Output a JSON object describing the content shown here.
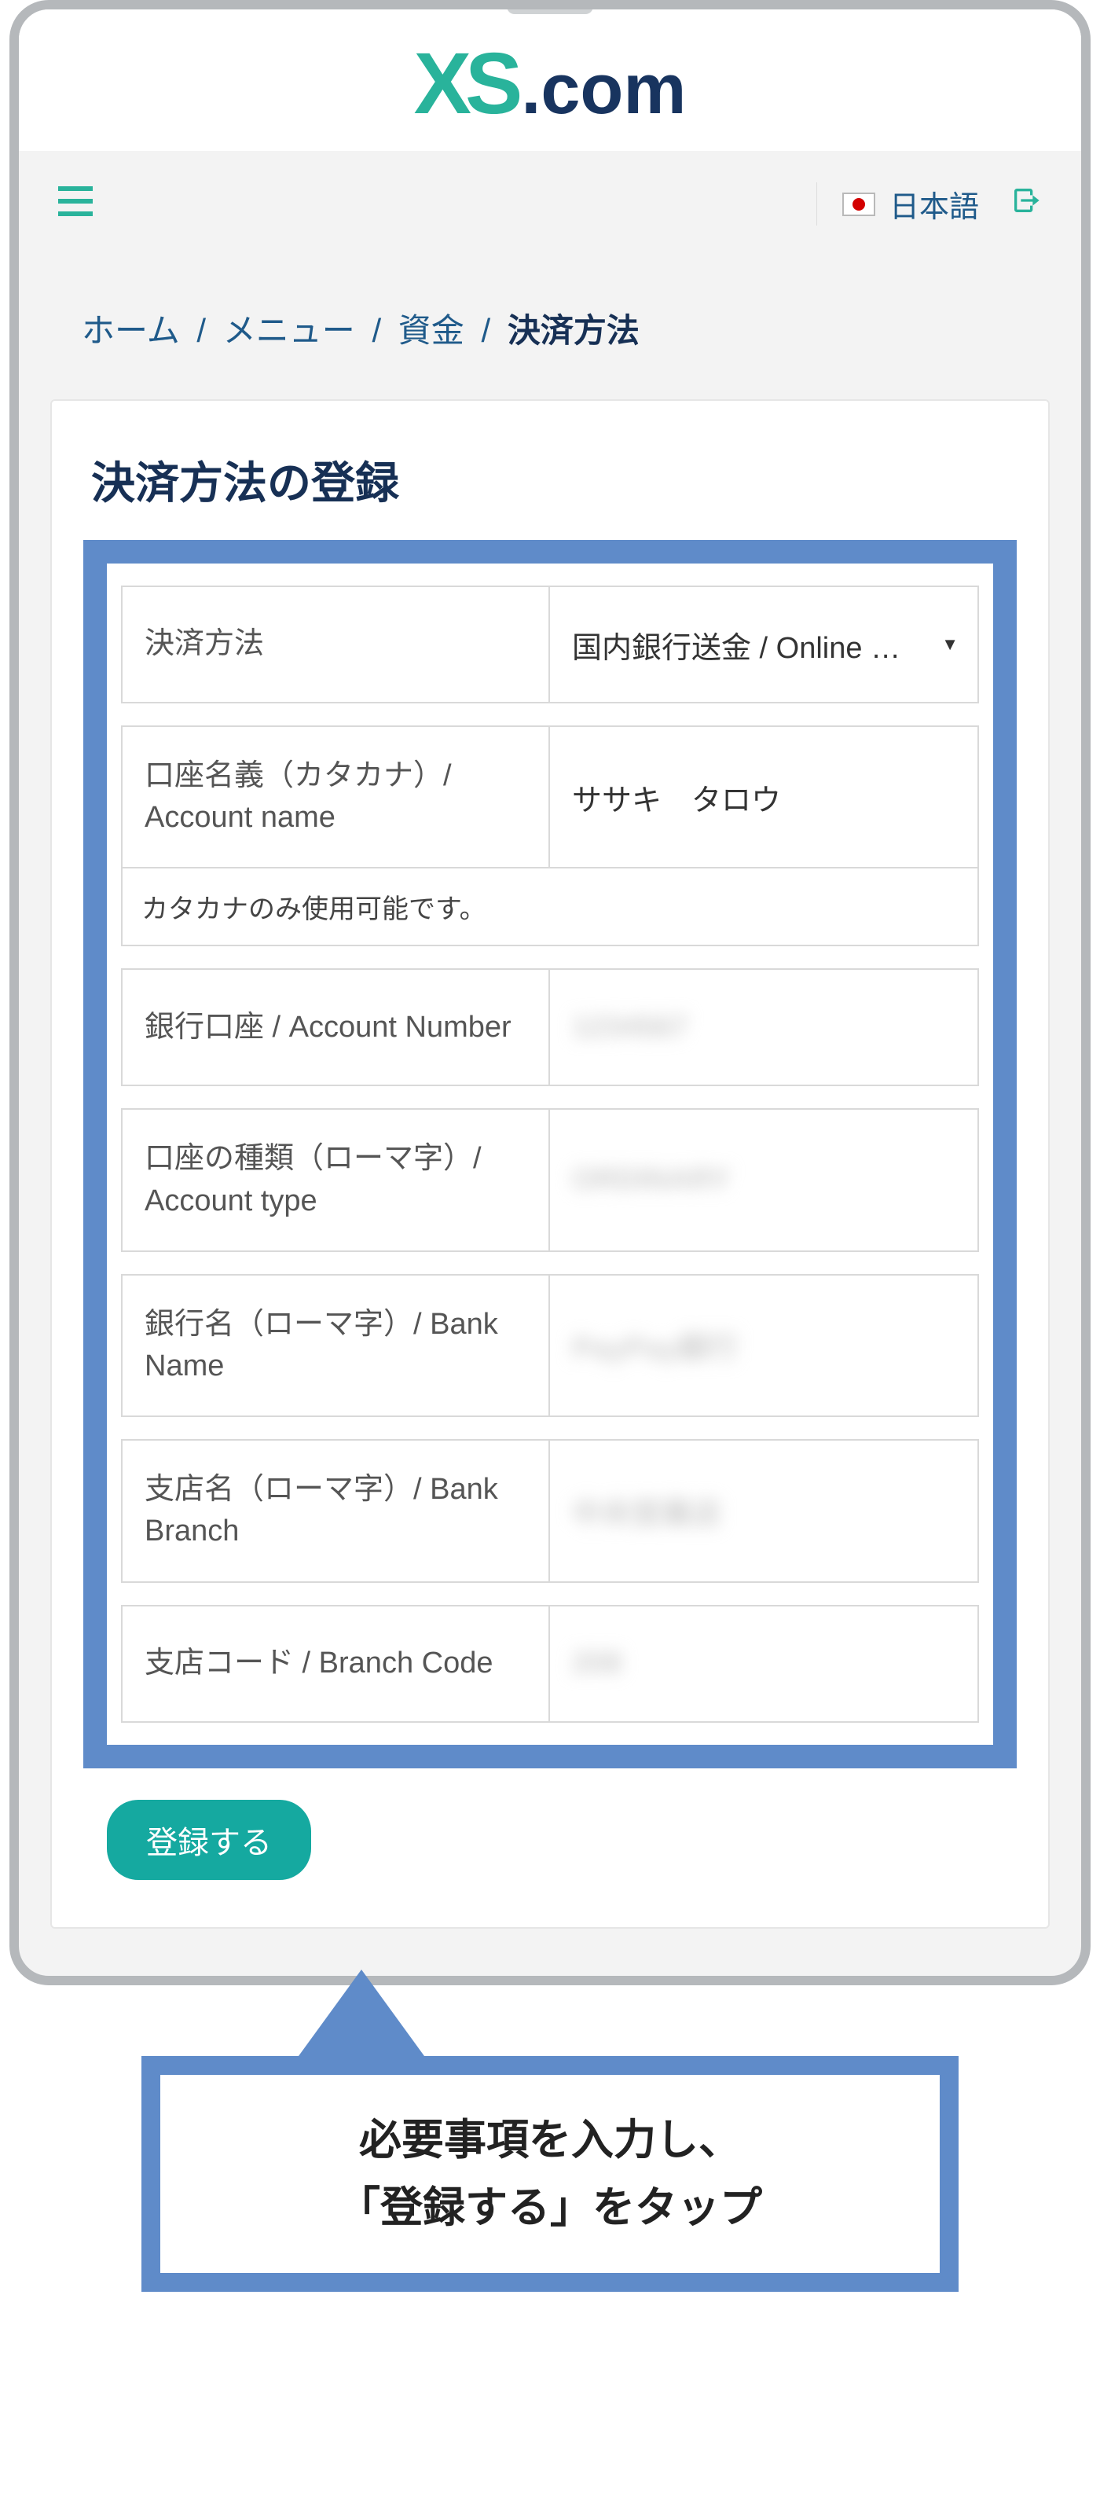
{
  "logo": {
    "xs": "XS",
    "com": ".com"
  },
  "topbar": {
    "language": "日本語"
  },
  "breadcrumb": {
    "home": "ホーム",
    "menu": "メニュー",
    "funds": "資金",
    "current": "決済方法"
  },
  "card": {
    "title": "決済方法の登録",
    "fields": {
      "method_label": "決済方法",
      "method_value": "国内銀行送金 / Online …",
      "name_label": "口座名義（カタカナ）/ Account name",
      "name_value": "ササキ　タロウ",
      "name_hint": "カタカナのみ使用可能です。",
      "acct_label": "銀行口座 / Account Number",
      "acct_value": "1234567",
      "type_label": "口座の種類（ローマ字）/ Account type",
      "type_value": "ORDINARY",
      "bank_label": "銀行名（ローマ字）/ Bank Name",
      "bank_value": "PayPay銀行",
      "branch_label": "支店名（ローマ字）/ Bank Branch",
      "branch_value": "中央営業店",
      "code_label": "支店コード / Branch Code",
      "code_value": "208"
    },
    "submit": "登録する"
  },
  "callout": {
    "line1": "必要事項を入力し、",
    "line2": "「登録する」をタップ"
  }
}
